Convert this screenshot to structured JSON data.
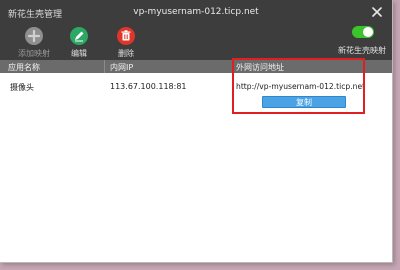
{
  "window": {
    "app_title": "新花生壳管理",
    "title": "vp-myusernam-012.ticp.net"
  },
  "toolbar": {
    "add_label": "添加映射",
    "edit_label": "编辑",
    "delete_label": "删除",
    "toggle_label": "新花生壳映射",
    "toggle_on": true
  },
  "table": {
    "columns": [
      "应用名称",
      "内网IP",
      "外网访问地址"
    ],
    "rows": [
      {
        "name": "摄像头",
        "ip": "113.67.100.118:81",
        "url": "http://vp-myusernam-012.ticp.net"
      }
    ]
  },
  "copy_button": {
    "label": "复制"
  },
  "colors": {
    "highlight": "#e02020",
    "toggle": "#3cc42d",
    "copy_button": "#4ba3e6",
    "edit_icon": "#2aa864",
    "delete_icon": "#e0352b"
  },
  "icons": {
    "add": "plus-circle-icon",
    "edit": "pencil-circle-icon",
    "delete": "trash-circle-icon",
    "close": "close-icon"
  }
}
